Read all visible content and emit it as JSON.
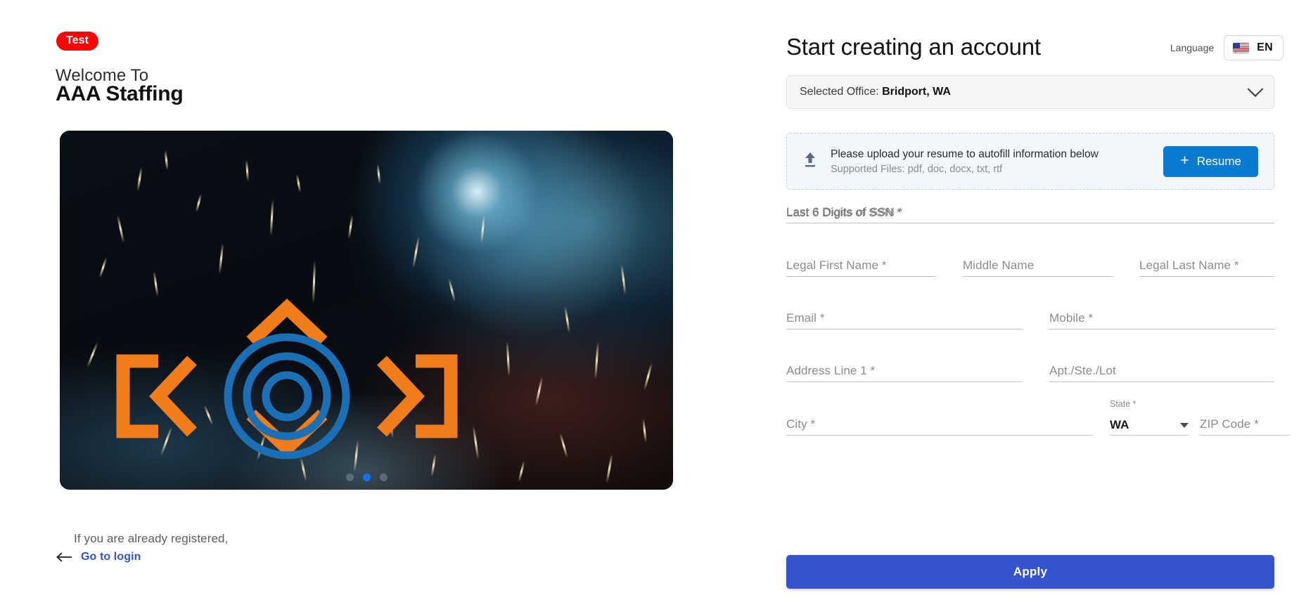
{
  "brand": {
    "badge": "Test",
    "welcome_line": "Welcome To",
    "company": "AAA Staffing"
  },
  "hero": {
    "carousel_dots": 3,
    "active_dot_index": 1,
    "overlay_accent_orange": "#f07d1a",
    "overlay_accent_blue": "#1a6fb5"
  },
  "login_prompt": {
    "text": "If you are already registered,",
    "link_label": "Go to login"
  },
  "form": {
    "title": "Start creating an account",
    "language": {
      "label": "Language",
      "code": "EN",
      "flag": "us-flag-icon"
    },
    "office": {
      "prefix": "Selected Office:",
      "value": "Bridport, WA"
    },
    "upload": {
      "icon": "upload-icon",
      "message": "Please upload your resume to autofill information below",
      "supported": "Supported Files: pdf, doc, docx, txt, rtf",
      "button_label": "Resume",
      "button_plus": "+",
      "button_color": "#0b7ad1"
    },
    "fields": {
      "ssn": {
        "placeholder": "Last 6 Digits of SSN *",
        "value": ""
      },
      "first_name": {
        "placeholder": "Legal First Name *",
        "value": ""
      },
      "middle_name": {
        "placeholder": "Middle Name",
        "value": ""
      },
      "last_name": {
        "placeholder": "Legal Last Name *",
        "value": ""
      },
      "email": {
        "placeholder": "Email *",
        "value": ""
      },
      "mobile": {
        "placeholder": "Mobile *",
        "value": ""
      },
      "address1": {
        "placeholder": "Address Line 1 *",
        "value": ""
      },
      "apt": {
        "placeholder": "Apt./Ste./Lot",
        "value": ""
      },
      "city": {
        "placeholder": "City *",
        "value": ""
      },
      "state": {
        "label": "State *",
        "value": "WA"
      },
      "zip": {
        "placeholder": "ZIP Code *",
        "value": ""
      }
    },
    "submit_label": "Apply",
    "submit_color": "#3553cc"
  }
}
